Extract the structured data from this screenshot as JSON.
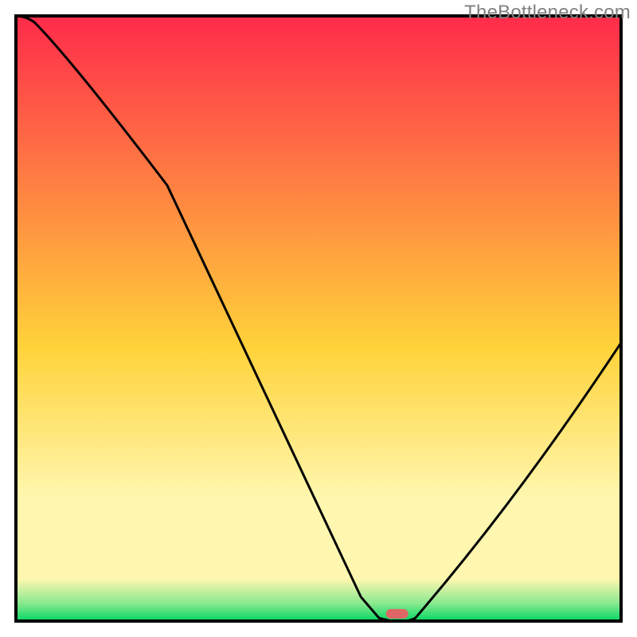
{
  "watermark": "TheBottleneck.com",
  "chart_data": {
    "type": "line",
    "title": "",
    "xlabel": "",
    "ylabel": "",
    "xlim": [
      0,
      100
    ],
    "ylim": [
      0,
      100
    ],
    "x": [
      0,
      3,
      25,
      57,
      60,
      62,
      64,
      66,
      100
    ],
    "values": [
      100,
      99,
      72,
      4,
      0.5,
      0,
      0,
      0.5,
      46
    ],
    "marker": {
      "x": 63,
      "height_pct": 1.2
    },
    "gradient_colors": {
      "top": "#ff2b4a",
      "mid": "#ffd33a",
      "pale": "#fff7b0",
      "green_top": "#8ce98f",
      "green": "#04d765"
    },
    "axis_color": "#000000",
    "curve_color": "#000000",
    "marker_color": "#e06666"
  }
}
